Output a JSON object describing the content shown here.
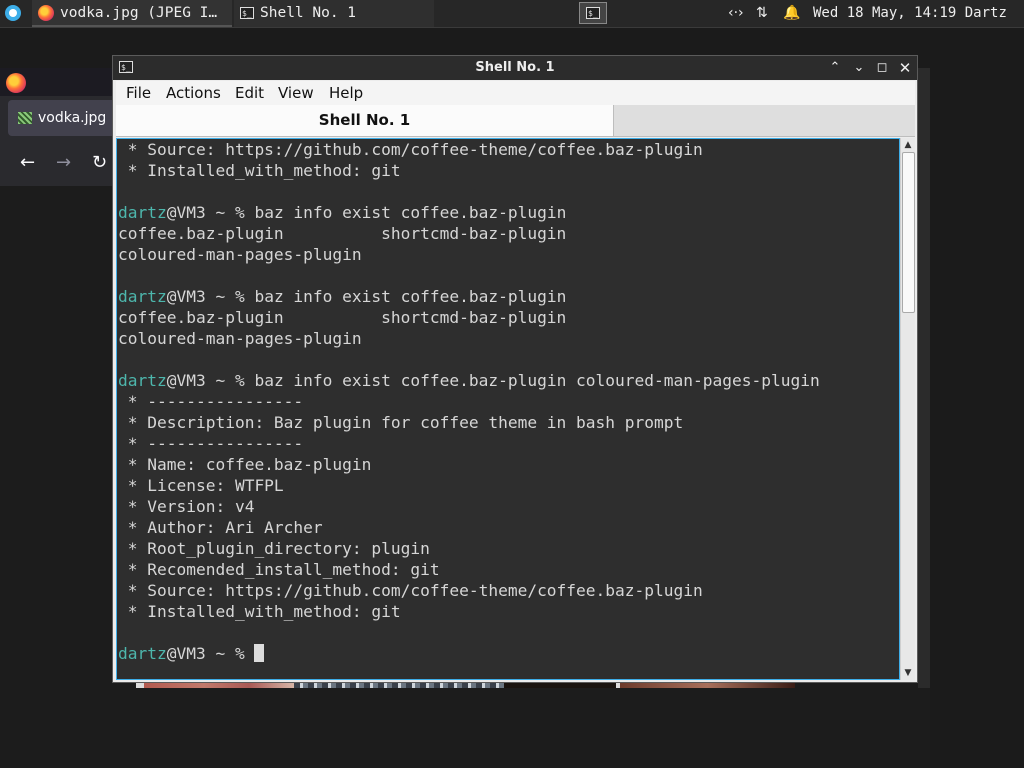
{
  "panel": {
    "tasks": [
      {
        "label": "vodka.jpg (JPEG I…",
        "icon": "firefox-icon"
      },
      {
        "label": "Shell No. 1",
        "icon": "terminal-icon"
      }
    ],
    "tray": {
      "network_glyph": "‹·›",
      "volume_glyph": "⇅",
      "bell_glyph": "🔔"
    },
    "clock": "Wed 18 May, 14:19",
    "user": "Dartz"
  },
  "browser": {
    "tab_label": "vodka.jpg",
    "nav": {
      "back": "←",
      "forward": "→",
      "reload": "↻"
    }
  },
  "terminal": {
    "title": "Shell No. 1",
    "window_buttons": {
      "shade": "⌃",
      "minimize": "⌄",
      "maximize": "◻",
      "close": "✕"
    },
    "menu": [
      "File",
      "Actions",
      "Edit",
      "View",
      "Help"
    ],
    "tab_label": "Shell No. 1",
    "scroll": {
      "up": "▲",
      "down": "▼",
      "thumb_start": 0.0,
      "thumb_size": 0.31
    },
    "lines": [
      {
        "text": " * Source: https://github.com/coffee-theme/coffee.baz-plugin"
      },
      {
        "text": " * Installed_with_method: git"
      },
      {
        "text": ""
      },
      {
        "user": "dartz",
        "prompt": "@VM3 ~ % ",
        "text": "baz info exist coffee.baz-plugin"
      },
      {
        "text": "coffee.baz-plugin          shortcmd-baz-plugin"
      },
      {
        "text": "coloured-man-pages-plugin"
      },
      {
        "text": ""
      },
      {
        "user": "dartz",
        "prompt": "@VM3 ~ % ",
        "text": "baz info exist coffee.baz-plugin"
      },
      {
        "text": "coffee.baz-plugin          shortcmd-baz-plugin"
      },
      {
        "text": "coloured-man-pages-plugin"
      },
      {
        "text": ""
      },
      {
        "user": "dartz",
        "prompt": "@VM3 ~ % ",
        "text": "baz info exist coffee.baz-plugin coloured-man-pages-plugin"
      },
      {
        "text": " * ----------------"
      },
      {
        "text": " * Description: Baz plugin for coffee theme in bash prompt"
      },
      {
        "text": " * ----------------"
      },
      {
        "text": " * Name: coffee.baz-plugin"
      },
      {
        "text": " * License: WTFPL"
      },
      {
        "text": " * Version: v4"
      },
      {
        "text": " * Author: Ari Archer"
      },
      {
        "text": " * Root_plugin_directory: plugin"
      },
      {
        "text": " * Recomended_install_method: git"
      },
      {
        "text": " * Source: https://github.com/coffee-theme/coffee.baz-plugin"
      },
      {
        "text": " * Installed_with_method: git"
      },
      {
        "text": ""
      },
      {
        "user": "dartz",
        "prompt": "@VM3 ~ % ",
        "text": "",
        "cursor": true
      }
    ]
  },
  "colors": {
    "prompt_user": "#4db6ac",
    "terminal_bg": "#2e2e2e",
    "terminal_fg": "#d6d6d6",
    "focus_border": "#3daee9"
  }
}
